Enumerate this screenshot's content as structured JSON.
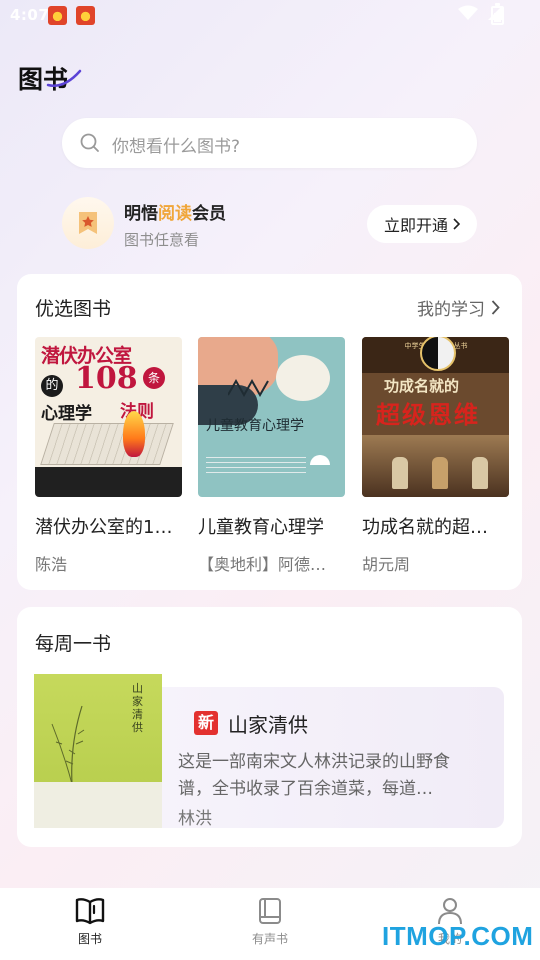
{
  "status_bar": {
    "time": "4:07"
  },
  "page": {
    "title": "图书"
  },
  "search": {
    "placeholder": "你想看什么图书?"
  },
  "membership": {
    "title_prefix": "明悟",
    "title_highlight": "阅读",
    "title_suffix": "会员",
    "subtitle": "图书任意看",
    "open_button": "立即开通"
  },
  "featured": {
    "title": "优选图书",
    "more_label": "我的学习",
    "books": [
      {
        "name": "潜伏办公室的1…",
        "author": "陈浩"
      },
      {
        "name": "儿童教育心理学",
        "author": "【奥地利】阿德…"
      },
      {
        "name": "功成名就的超…",
        "author": "胡元周"
      }
    ]
  },
  "covers": {
    "book1": {
      "line1": "潜伏办公室",
      "de": "的",
      "num": "108",
      "tiao": "条",
      "line2a": "心理学",
      "line2b": "法则"
    },
    "book2": {
      "title": "儿童教育心理学"
    },
    "book3": {
      "series": "中学生名著导读丛书",
      "line1": "功成名就的",
      "line2": "超级恩维"
    },
    "weekly": {
      "title": "山家清供"
    }
  },
  "weekly": {
    "title": "每周一书",
    "tag": "新",
    "book_name": "山家清供",
    "description": "这是一部南宋文人林洪记录的山野食谱，全书收录了百余道菜，每道…",
    "author": "林洪"
  },
  "tabbar": {
    "items": [
      {
        "label": "图书",
        "active": true
      },
      {
        "label": "有声书",
        "active": false
      },
      {
        "label": "我的",
        "active": false
      }
    ]
  },
  "watermark": {
    "text": "ITMOP.COM"
  },
  "colors": {
    "accent": "#f0a63a",
    "new_tag": "#e3312f",
    "watermark": "#1fa3e0"
  }
}
